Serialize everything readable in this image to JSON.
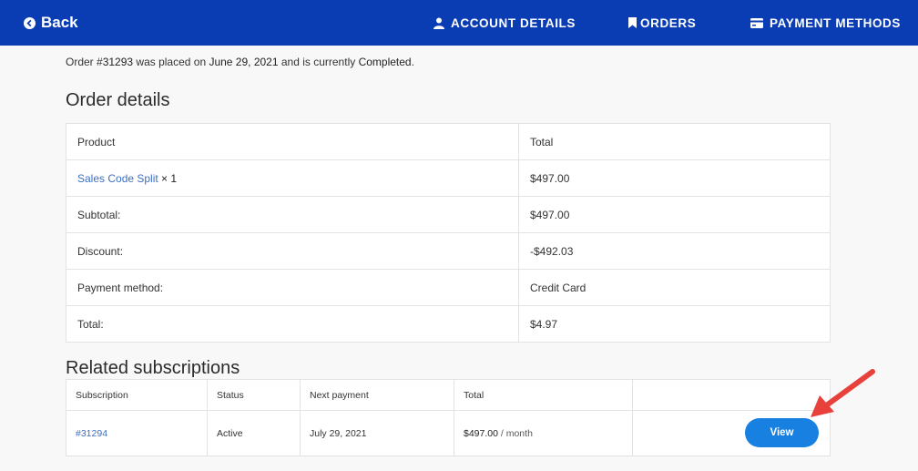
{
  "header": {
    "back_label": "Back",
    "nav": {
      "account": "ACCOUNT DETAILS",
      "orders": "ORDERS",
      "payments": "PAYMENT METHODS"
    }
  },
  "intro": {
    "pre": "Order #",
    "order_number": "31293",
    "mid1": " was placed on ",
    "date": "June 29, 2021",
    "mid2": " and is currently ",
    "status": "Completed",
    "post": "."
  },
  "order_details": {
    "title": "Order details",
    "headers": {
      "product": "Product",
      "total": "Total"
    },
    "item": {
      "name": "Sales Code Split",
      "qty": " × 1",
      "total": "$497.00"
    },
    "rows": [
      {
        "label": "Subtotal:",
        "value": "$497.00"
      },
      {
        "label": "Discount:",
        "value": "-$492.03"
      },
      {
        "label": "Payment method:",
        "value": "Credit Card"
      },
      {
        "label": "Total:",
        "value": "$4.97"
      }
    ]
  },
  "related": {
    "title": "Related subscriptions",
    "headers": {
      "subscription": "Subscription",
      "status": "Status",
      "next_payment": "Next payment",
      "total": "Total"
    },
    "row": {
      "id": "#31294",
      "status": "Active",
      "next_payment": "July 29, 2021",
      "total": "$497.00",
      "period": " / month",
      "view_label": "View"
    }
  },
  "colors": {
    "header_bg": "#0a3db3",
    "button": "#1780e0",
    "link": "#3b6fc4",
    "annotation_arrow": "#e8413b"
  },
  "icons": {
    "back": "arrow-left-circle-icon",
    "account": "user-icon",
    "orders": "bookmark-icon",
    "payments": "credit-card-icon",
    "annotation": "red-arrow-icon"
  }
}
